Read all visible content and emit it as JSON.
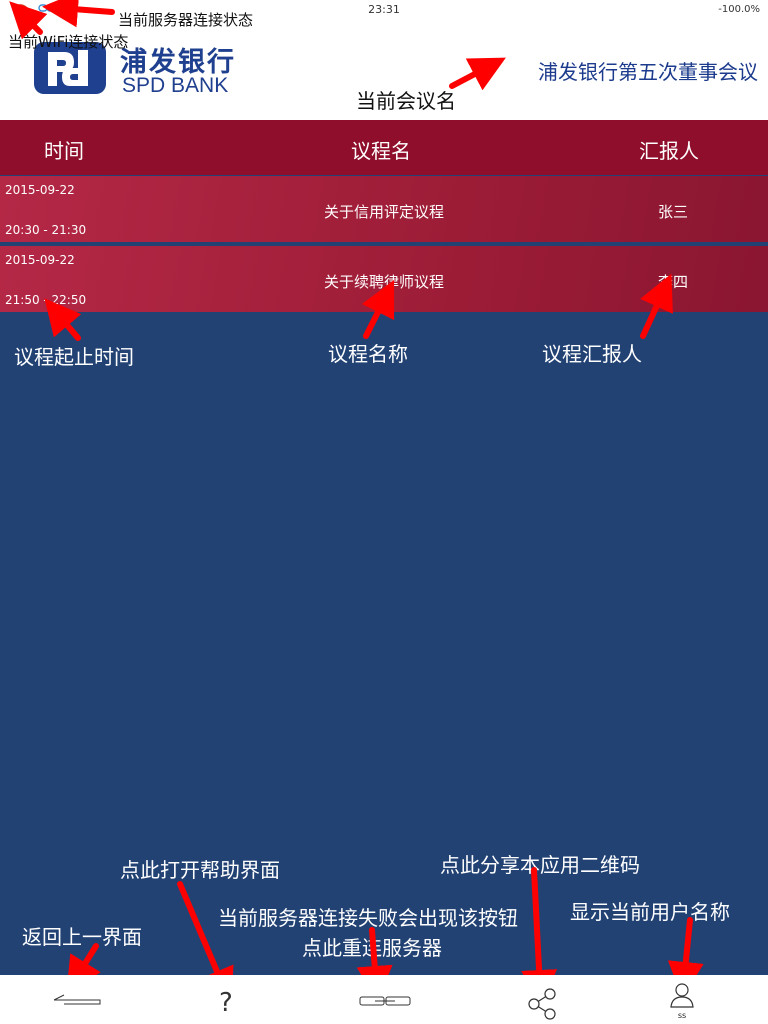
{
  "status_bar": {
    "time": "23:31",
    "battery": "-100.0%"
  },
  "logo": {
    "cn": "浦发银行",
    "en": "SPD BANK"
  },
  "meeting": {
    "name": "浦发银行第五次董事会议"
  },
  "table": {
    "headers": {
      "time": "时间",
      "name": "议程名",
      "reporter": "汇报人"
    },
    "rows": [
      {
        "date": "2015-09-22",
        "range": "20:30 - 21:30",
        "title": "关于信用评定议程",
        "reporter": "张三"
      },
      {
        "date": "2015-09-22",
        "range": "21:50 - 22:50",
        "title": "关于续聘律师议程",
        "reporter": "李四"
      }
    ]
  },
  "annotations": {
    "server_status": "当前服务器连接状态",
    "wifi_status": "当前WiFi连接状态",
    "meeting_name": "当前会议名",
    "agenda_time": "议程起止时间",
    "agenda_name": "议程名称",
    "agenda_reporter": "议程汇报人",
    "help": "点此打开帮助界面",
    "share": "点此分享本应用二维码",
    "back": "返回上一界面",
    "reconnect_line1": "当前服务器连接失败会出现该按钮",
    "reconnect_line2": "点此重连服务器",
    "user_name": "显示当前用户名称"
  },
  "bottom_bar": {
    "user_name": "ss"
  },
  "icons": [
    "wifi-icon",
    "server-link-icon",
    "back-arrow-icon",
    "help-icon",
    "reconnect-icon",
    "share-icon",
    "user-icon"
  ],
  "colors": {
    "header": "#8e0e2b",
    "background": "#224274",
    "row": "#b42846",
    "brand": "#1f3f8f",
    "arrow": "#ff0000"
  }
}
